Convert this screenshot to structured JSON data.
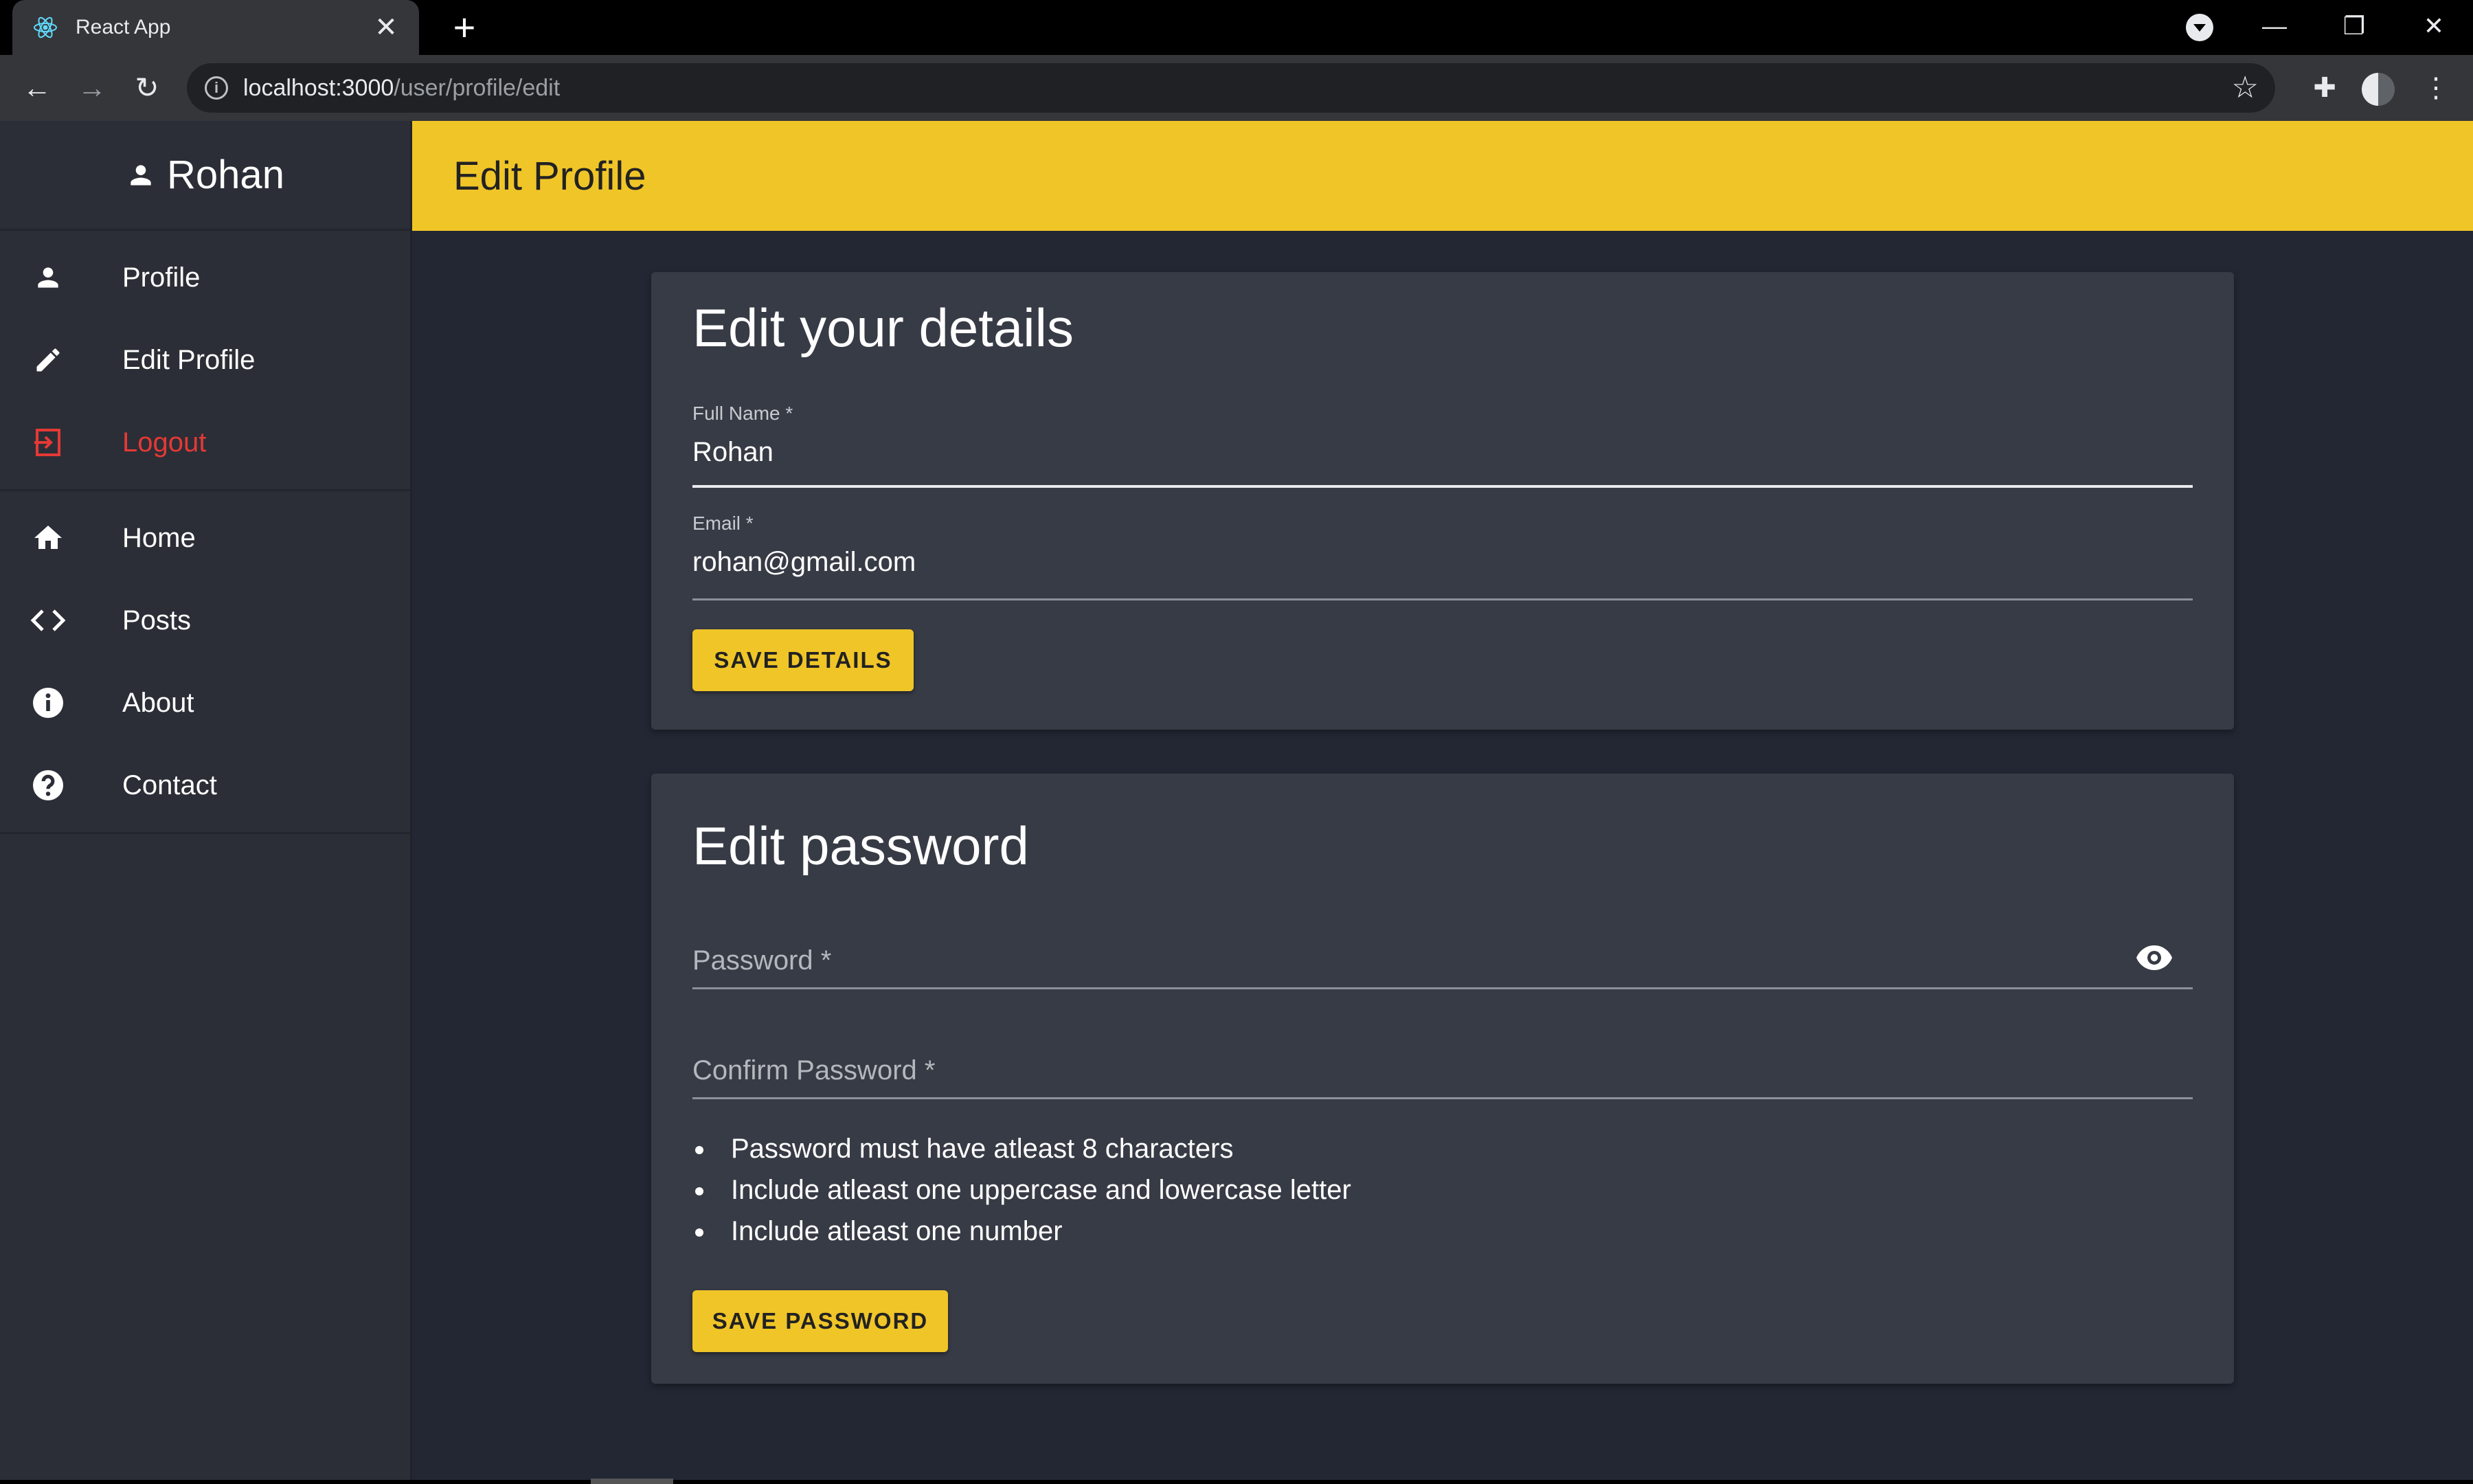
{
  "browser": {
    "tab_title": "React App",
    "tab_close": "✕",
    "new_tab": "+",
    "url_host": "localhost:3000",
    "url_path": "/user/profile/edit",
    "back": "←",
    "forward": "→",
    "reload": "↻",
    "star": "☆",
    "extensions": "✚",
    "menu": "⋮",
    "minimize": "—",
    "restore": "❐",
    "close": "✕"
  },
  "sidebar": {
    "user_name": "Rohan",
    "primary_items": [
      {
        "label": "Profile",
        "icon": "person-icon"
      },
      {
        "label": "Edit Profile",
        "icon": "pencil-icon"
      },
      {
        "label": "Logout",
        "icon": "logout-icon"
      }
    ],
    "secondary_items": [
      {
        "label": "Home",
        "icon": "home-icon"
      },
      {
        "label": "Posts",
        "icon": "code-icon"
      },
      {
        "label": "About",
        "icon": "info-icon"
      },
      {
        "label": "Contact",
        "icon": "help-icon"
      }
    ]
  },
  "header": {
    "title": "Edit Profile"
  },
  "details_card": {
    "title": "Edit your details",
    "full_name_label": "Full Name *",
    "full_name_value": "Rohan",
    "email_label": "Email *",
    "email_value": "rohan@gmail.com",
    "save_label": "SAVE DETAILS"
  },
  "password_card": {
    "title": "Edit password",
    "password_label": "Password *",
    "confirm_label": "Confirm Password *",
    "rules": [
      "Password must have atleast 8 characters",
      "Include atleast one uppercase and lowercase letter",
      "Include atleast one number"
    ],
    "save_label": "SAVE PASSWORD"
  },
  "colors": {
    "accent": "#f0c528",
    "sidebar_bg": "#2b2e36",
    "main_bg": "#222733",
    "card_bg": "#373b45",
    "logout": "#e53935"
  }
}
